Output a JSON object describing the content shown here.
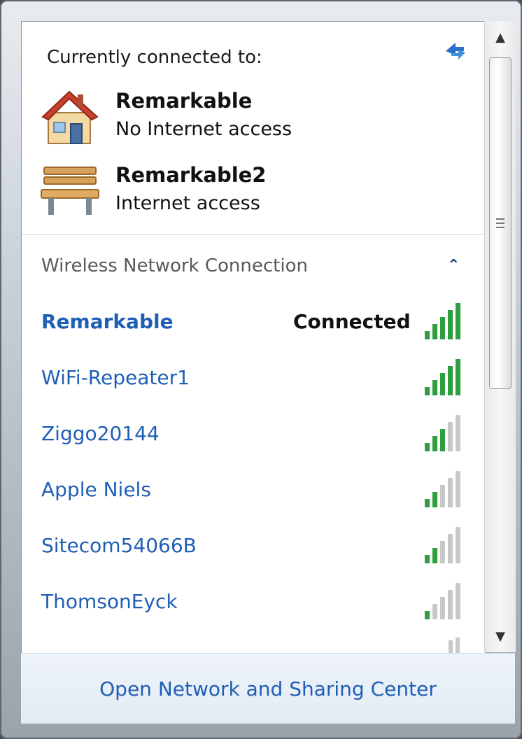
{
  "header": {
    "title": "Currently connected to:"
  },
  "current_connections": [
    {
      "name": "Remarkable",
      "status": "No Internet access",
      "icon": "house-icon"
    },
    {
      "name": "Remarkable2",
      "status": "Internet access",
      "icon": "bench-icon"
    }
  ],
  "wireless": {
    "section_title": "Wireless Network Connection",
    "networks": [
      {
        "name": "Remarkable",
        "status": "Connected",
        "signal_bars": 5
      },
      {
        "name": "WiFi-Repeater1",
        "status": "",
        "signal_bars": 5
      },
      {
        "name": "Ziggo20144",
        "status": "",
        "signal_bars": 3
      },
      {
        "name": "Apple Niels",
        "status": "",
        "signal_bars": 2
      },
      {
        "name": "Sitecom54066B",
        "status": "",
        "signal_bars": 2
      },
      {
        "name": "ThomsonEyck",
        "status": "",
        "signal_bars": 1
      }
    ]
  },
  "footer": {
    "link": "Open Network and Sharing Center"
  },
  "colors": {
    "link": "#1e5fb5",
    "signal_on": "#2e9e3e",
    "signal_off": "#c8c8c8"
  }
}
